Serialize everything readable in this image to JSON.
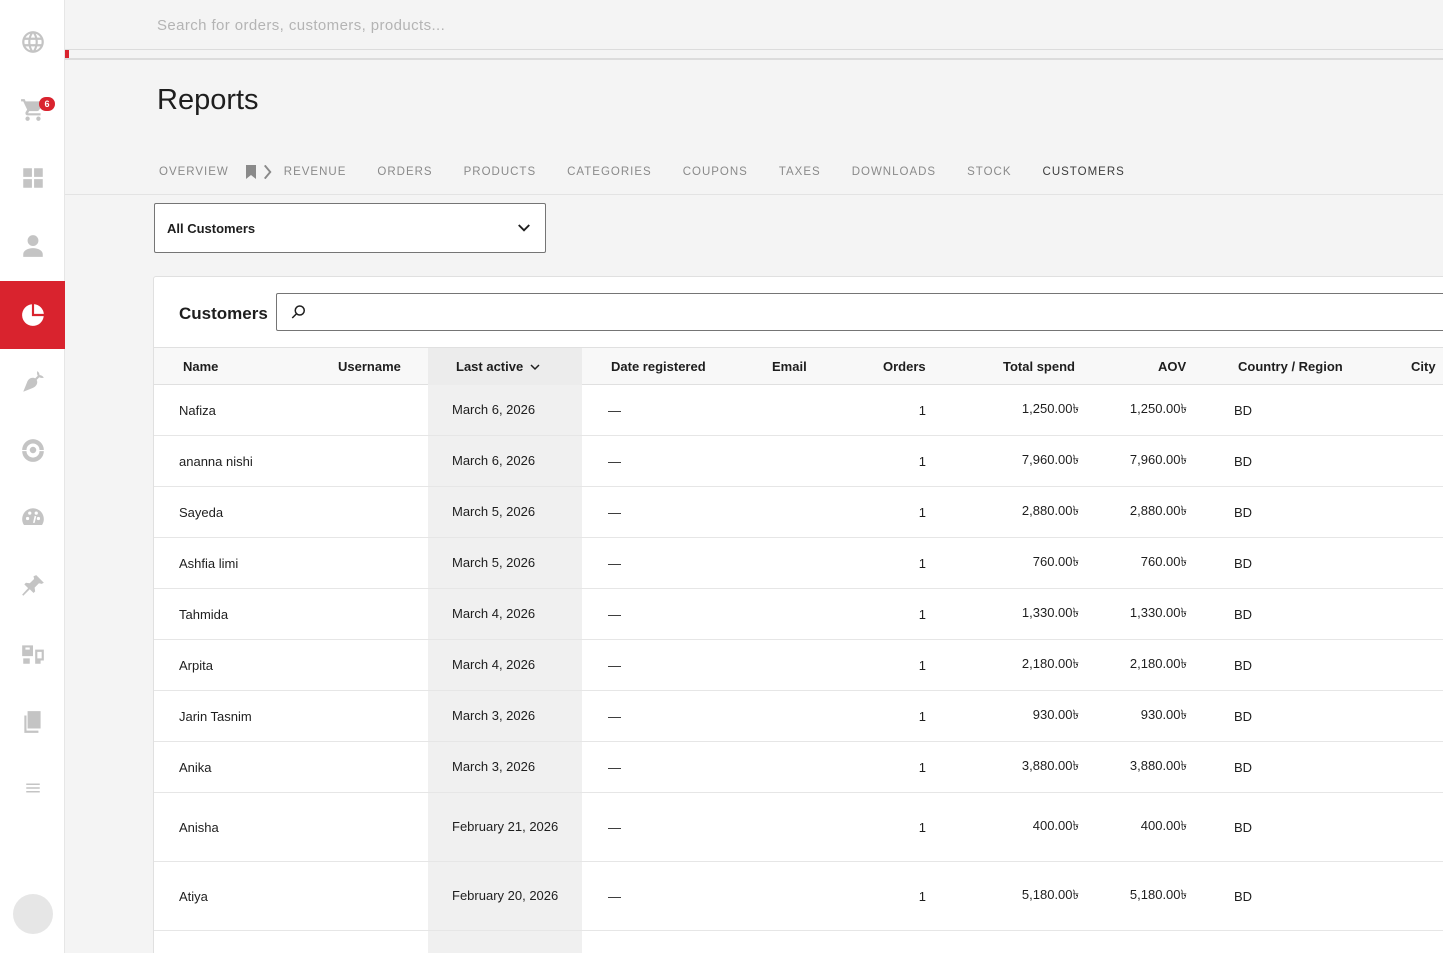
{
  "sidebar": {
    "items": [
      {
        "icon": "globe-icon"
      },
      {
        "icon": "cart-icon",
        "badge": "6"
      },
      {
        "icon": "dashboard-grid-icon"
      },
      {
        "icon": "user-icon"
      },
      {
        "icon": "pie-chart-icon",
        "active": true
      },
      {
        "icon": "carrot-icon"
      },
      {
        "icon": "marketing-icon"
      },
      {
        "icon": "palette-icon"
      },
      {
        "icon": "pin-icon"
      },
      {
        "icon": "settings-media-icon"
      },
      {
        "icon": "pages-icon"
      },
      {
        "icon": "menu-icon"
      }
    ]
  },
  "topbar": {
    "search_placeholder": "Search for orders, customers, products..."
  },
  "page": {
    "title": "Reports"
  },
  "tabs": [
    "Overview",
    "Revenue",
    "Orders",
    "Products",
    "Categories",
    "Coupons",
    "Taxes",
    "Downloads",
    "Stock",
    "Customers"
  ],
  "active_tab": "Customers",
  "filter": {
    "value": "All Customers"
  },
  "table": {
    "title": "Customers",
    "columns": {
      "name": "Name",
      "username": "Username",
      "last_active": "Last active",
      "date_registered": "Date registered",
      "email": "Email",
      "orders": "Orders",
      "total_spend": "Total spend",
      "aov": "AOV",
      "country": "Country / Region",
      "city": "City"
    },
    "rows": [
      {
        "name": "Nafiza",
        "last_active": "March 6, 2026",
        "date_registered": "—",
        "orders": "1",
        "total_spend": "1,250.00৳",
        "aov": "1,250.00৳",
        "country": "BD"
      },
      {
        "name": "ananna nishi",
        "last_active": "March 6, 2026",
        "date_registered": "—",
        "orders": "1",
        "total_spend": "7,960.00৳",
        "aov": "7,960.00৳",
        "country": "BD"
      },
      {
        "name": "Sayeda",
        "last_active": "March 5, 2026",
        "date_registered": "—",
        "orders": "1",
        "total_spend": "2,880.00৳",
        "aov": "2,880.00৳",
        "country": "BD"
      },
      {
        "name": "Ashfia limi",
        "last_active": "March 5, 2026",
        "date_registered": "—",
        "orders": "1",
        "total_spend": "760.00৳",
        "aov": "760.00৳",
        "country": "BD"
      },
      {
        "name": "Tahmida",
        "last_active": "March 4, 2026",
        "date_registered": "—",
        "orders": "1",
        "total_spend": "1,330.00৳",
        "aov": "1,330.00৳",
        "country": "BD"
      },
      {
        "name": "Arpita",
        "last_active": "March 4, 2026",
        "date_registered": "—",
        "orders": "1",
        "total_spend": "2,180.00৳",
        "aov": "2,180.00৳",
        "country": "BD"
      },
      {
        "name": "Jarin Tasnim",
        "last_active": "March 3, 2026",
        "date_registered": "—",
        "orders": "1",
        "total_spend": "930.00৳",
        "aov": "930.00৳",
        "country": "BD"
      },
      {
        "name": "Anika",
        "last_active": "March 3, 2026",
        "date_registered": "—",
        "orders": "1",
        "total_spend": "3,880.00৳",
        "aov": "3,880.00৳",
        "country": "BD"
      },
      {
        "name": "Anisha",
        "last_active": "February 21, 2026",
        "date_registered": "—",
        "orders": "1",
        "total_spend": "400.00৳",
        "aov": "400.00৳",
        "country": "BD"
      },
      {
        "name": "Atiya",
        "last_active": "February 20, 2026",
        "date_registered": "—",
        "orders": "1",
        "total_spend": "5,180.00৳",
        "aov": "5,180.00৳",
        "country": "BD"
      }
    ]
  },
  "colors": {
    "accent": "#d9232e",
    "sidebar_icon": "#c4c4c4",
    "background": "#f4f4f4"
  }
}
